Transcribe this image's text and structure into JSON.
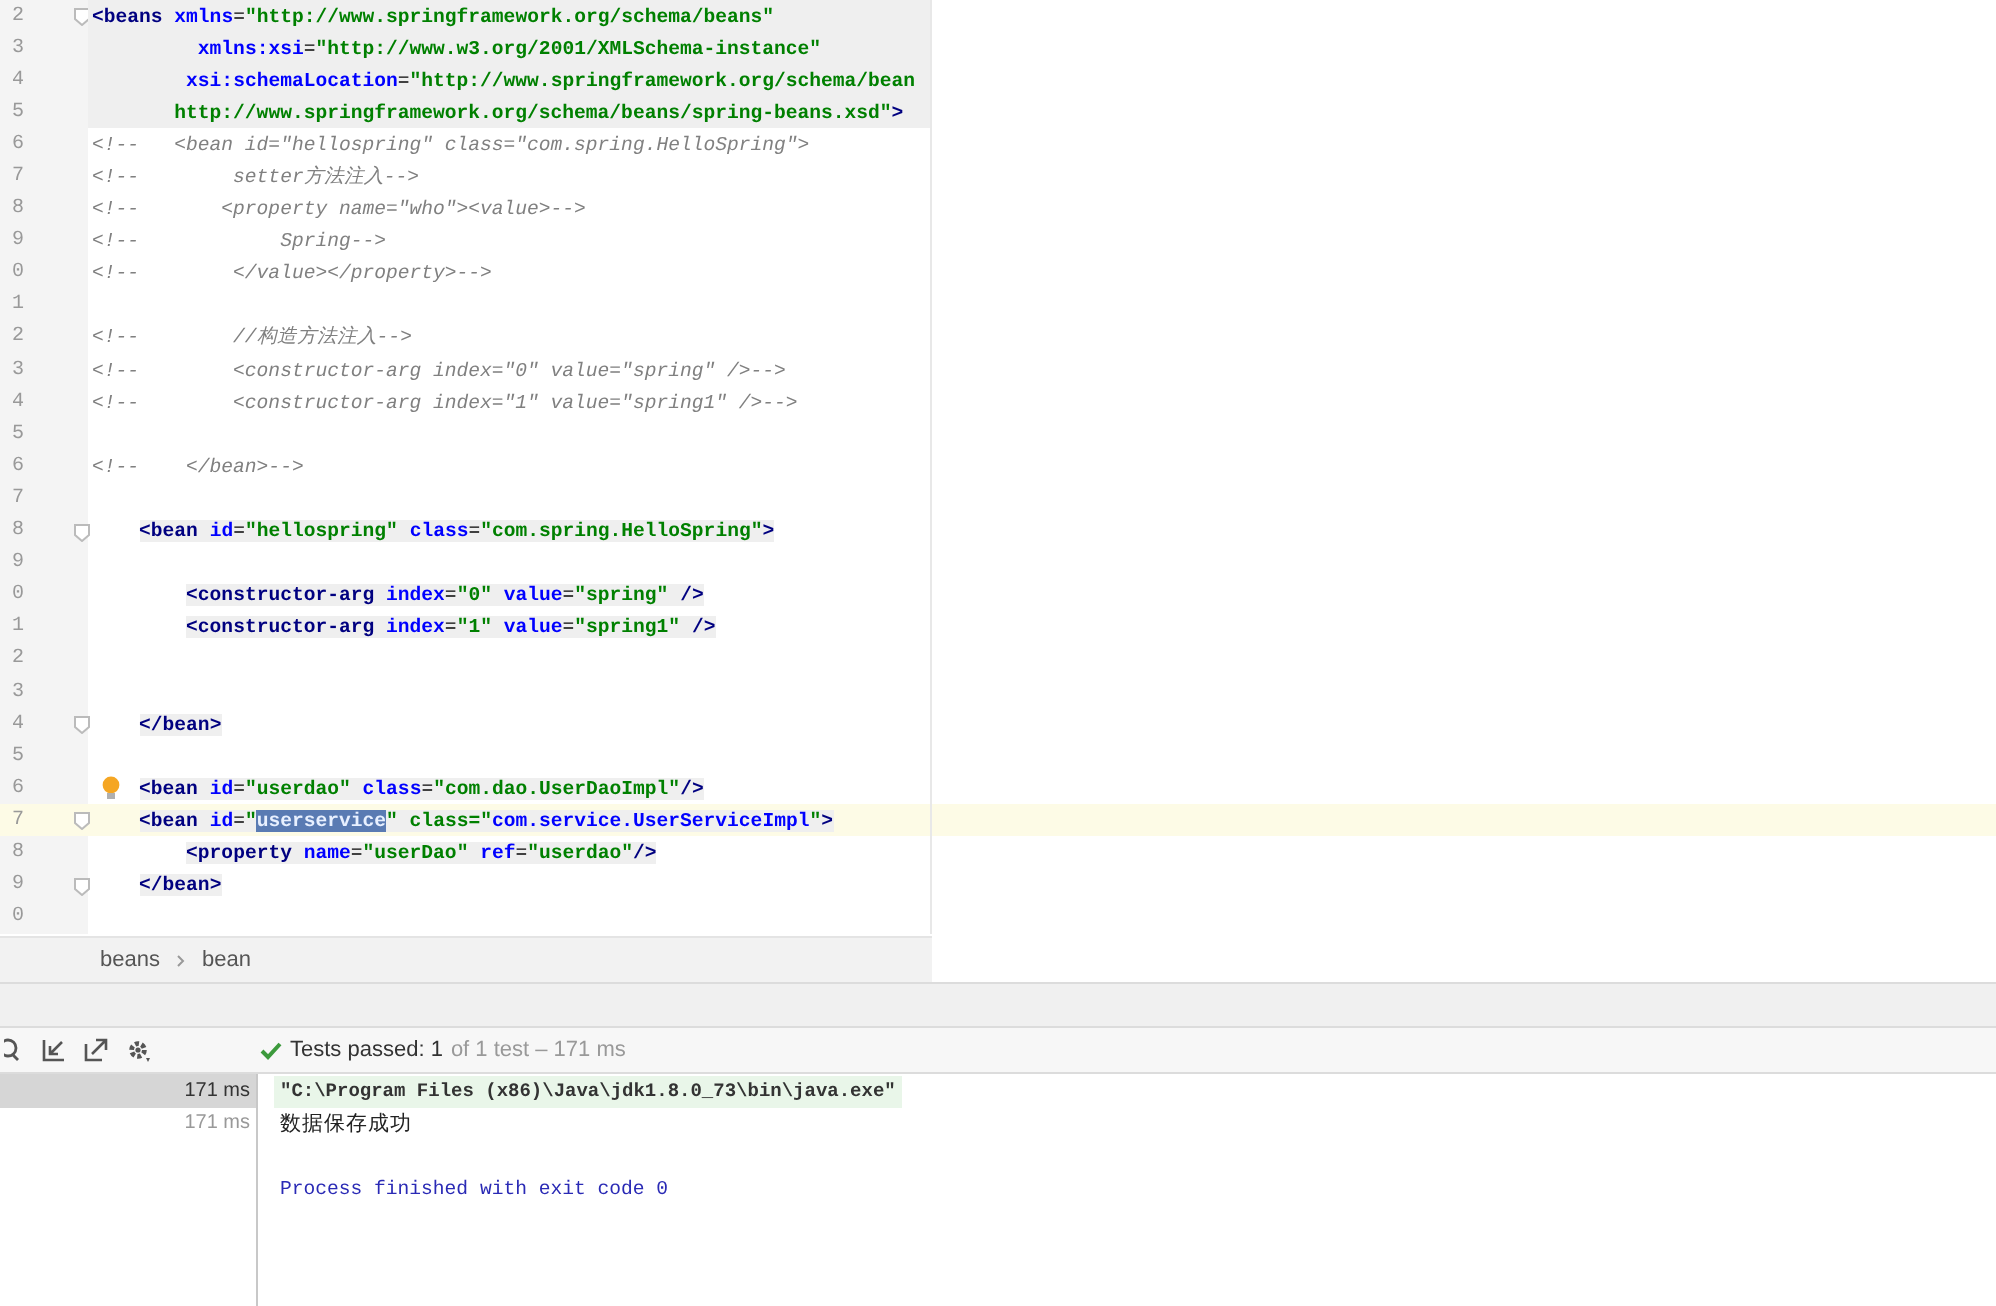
{
  "editor": {
    "lines": [
      {
        "num": "2",
        "kind": "header",
        "fold": true,
        "bulb": false,
        "current": false,
        "text": "<beans xmlns=\"http://www.springframework.org/schema/beans\""
      },
      {
        "num": "3",
        "kind": "header",
        "fold": false,
        "bulb": false,
        "current": false,
        "text": "         xmlns:xsi=\"http://www.w3.org/2001/XMLSchema-instance\""
      },
      {
        "num": "4",
        "kind": "header",
        "fold": false,
        "bulb": false,
        "current": false,
        "text": "        xsi:schemaLocation=\"http://www.springframework.org/schema/bean"
      },
      {
        "num": "5",
        "kind": "header",
        "fold": false,
        "bulb": false,
        "current": false,
        "text": "       http://www.springframework.org/schema/beans/spring-beans.xsd\">"
      },
      {
        "num": "6",
        "kind": "comment",
        "fold": false,
        "bulb": false,
        "current": false,
        "text": "<!--   <bean id=\"hellospring\" class=\"com.spring.HelloSpring\">"
      },
      {
        "num": "7",
        "kind": "comment",
        "fold": false,
        "bulb": false,
        "current": false,
        "text": "<!--        setter方法注入-->"
      },
      {
        "num": "8",
        "kind": "comment",
        "fold": false,
        "bulb": false,
        "current": false,
        "text": "<!--       <property name=\"who\"><value>-->"
      },
      {
        "num": "9",
        "kind": "comment",
        "fold": false,
        "bulb": false,
        "current": false,
        "text": "<!--            Spring-->"
      },
      {
        "num": "0",
        "kind": "comment",
        "fold": false,
        "bulb": false,
        "current": false,
        "text": "<!--        </value></property>-->"
      },
      {
        "num": "1",
        "kind": "blank",
        "fold": false,
        "bulb": false,
        "current": false
      },
      {
        "num": "2",
        "kind": "comment",
        "fold": false,
        "bulb": false,
        "current": false,
        "text": "<!--        //构造方法注入-->"
      },
      {
        "num": "3",
        "kind": "comment",
        "fold": false,
        "bulb": false,
        "current": false,
        "text": "<!--        <constructor-arg index=\"0\" value=\"spring\" />-->"
      },
      {
        "num": "4",
        "kind": "comment",
        "fold": false,
        "bulb": false,
        "current": false,
        "text": "<!--        <constructor-arg index=\"1\" value=\"spring1\" />-->"
      },
      {
        "num": "5",
        "kind": "blank",
        "fold": false,
        "bulb": false,
        "current": false
      },
      {
        "num": "6",
        "kind": "comment",
        "fold": false,
        "bulb": false,
        "current": false,
        "text": "<!--    </bean>-->"
      },
      {
        "num": "7",
        "kind": "blank",
        "fold": false,
        "bulb": false,
        "current": false
      },
      {
        "num": "8",
        "kind": "code",
        "fold": true,
        "bulb": false,
        "current": false,
        "text": "    <bean id=\"hellospring\" class=\"com.spring.HelloSpring\">"
      },
      {
        "num": "9",
        "kind": "blank",
        "fold": false,
        "bulb": false,
        "current": false
      },
      {
        "num": "0",
        "kind": "code",
        "fold": false,
        "bulb": false,
        "current": false,
        "text": "        <constructor-arg index=\"0\" value=\"spring\" />"
      },
      {
        "num": "1",
        "kind": "code",
        "fold": false,
        "bulb": false,
        "current": false,
        "text": "        <constructor-arg index=\"1\" value=\"spring1\" />"
      },
      {
        "num": "2",
        "kind": "blank",
        "fold": false,
        "bulb": false,
        "current": false
      },
      {
        "num": "3",
        "kind": "blank",
        "fold": false,
        "bulb": false,
        "current": false
      },
      {
        "num": "4",
        "kind": "code",
        "fold": true,
        "bulb": false,
        "current": false,
        "text": "    </bean>"
      },
      {
        "num": "5",
        "kind": "blank",
        "fold": false,
        "bulb": false,
        "current": false
      },
      {
        "num": "6",
        "kind": "code",
        "fold": false,
        "bulb": true,
        "current": false,
        "text": "    <bean id=\"userdao\" class=\"com.dao.UserDaoImpl\"/>"
      },
      {
        "num": "7",
        "kind": "code",
        "fold": true,
        "bulb": false,
        "current": true,
        "text": "    <bean id=\"",
        "selected_text": "userservice",
        "text_after": "\" class=\"com.service.UserServiceImpl\">"
      },
      {
        "num": "8",
        "kind": "code",
        "fold": false,
        "bulb": false,
        "current": false,
        "text": "        <property name=\"userDao\" ref=\"userdao\"/>"
      },
      {
        "num": "9",
        "kind": "code",
        "fold": true,
        "bulb": false,
        "current": false,
        "text": "    </bean>"
      },
      {
        "num": "0",
        "kind": "blank",
        "fold": false,
        "bulb": false,
        "current": false
      }
    ]
  },
  "breadcrumbs": [
    "beans",
    "bean"
  ],
  "test_bar": {
    "status": "Tests passed: 1",
    "detail": "of 1 test – 171 ms"
  },
  "test_tree": [
    {
      "time": "171 ms",
      "selected": true
    },
    {
      "time": "171 ms",
      "selected": false
    }
  ],
  "console": [
    {
      "kind": "command",
      "text": "\"C:\\Program Files (x86)\\Java\\jdk1.8.0_73\\bin\\java.exe\""
    },
    {
      "kind": "output",
      "text": "数据保存成功"
    },
    {
      "kind": "system",
      "text": "Process finished with exit code 0"
    }
  ]
}
